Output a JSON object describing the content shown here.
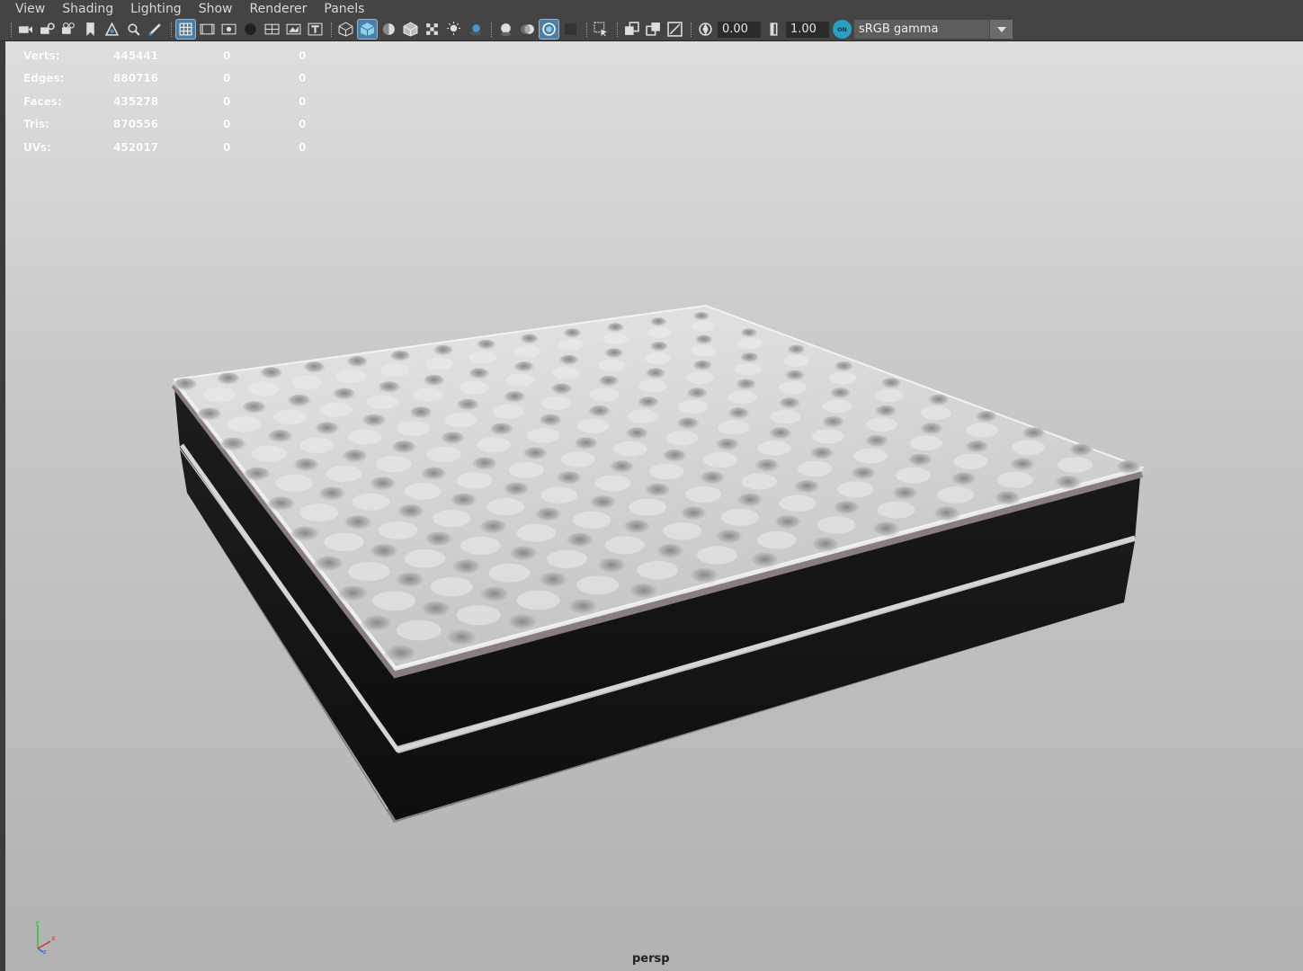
{
  "menu": [
    "View",
    "Shading",
    "Lighting",
    "Show",
    "Renderer",
    "Panels"
  ],
  "toolbar": {
    "exposure_value": "0.00",
    "gamma_value": "1.00",
    "color_management_badge": "ON",
    "color_space": "sRGB gamma"
  },
  "hud": {
    "rows": [
      {
        "label": "Verts:",
        "v1": "445441",
        "v2": "0",
        "v3": "0"
      },
      {
        "label": "Edges:",
        "v1": "880716",
        "v2": "0",
        "v3": "0"
      },
      {
        "label": "Faces:",
        "v1": "435278",
        "v2": "0",
        "v3": "0"
      },
      {
        "label": "Tris:",
        "v1": "870556",
        "v2": "0",
        "v3": "0"
      },
      {
        "label": "UVs:",
        "v1": "452017",
        "v2": "0",
        "v3": "0"
      }
    ]
  },
  "viewport": {
    "camera": "persp",
    "axes": {
      "y": "y",
      "x": "x",
      "z": "z"
    }
  },
  "colors": {
    "selection_accent": "#4b7fa8",
    "mattress_top": "#d9d9d9",
    "mattress_side": "#141414",
    "piping": "#8a7d7f"
  }
}
